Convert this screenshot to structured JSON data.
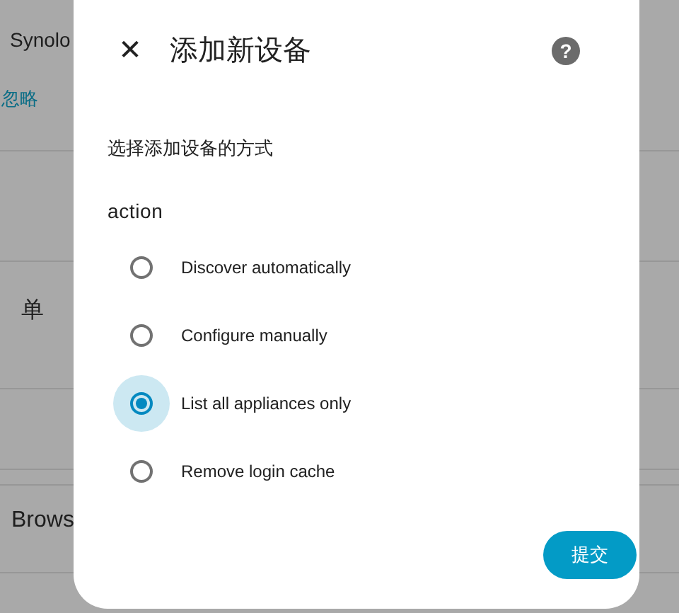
{
  "background": {
    "items": [
      {
        "kind": "subtext",
        "text": "Synolo"
      },
      {
        "kind": "link",
        "text": "忽略"
      },
      {
        "kind": "rule"
      },
      {
        "kind": "heading",
        "text": "单"
      },
      {
        "kind": "rule"
      },
      {
        "kind": "heading",
        "text": "Brows"
      }
    ]
  },
  "dialog": {
    "title": "添加新设备",
    "close_icon": "✕",
    "help": "?",
    "description": "选择添加设备的方式",
    "field_label": "action",
    "options": [
      {
        "label": "Discover automatically",
        "selected": false
      },
      {
        "label": "Configure manually",
        "selected": false
      },
      {
        "label": "List all appliances only",
        "selected": true
      },
      {
        "label": "Remove login cache",
        "selected": false
      }
    ],
    "submit": "提交"
  }
}
